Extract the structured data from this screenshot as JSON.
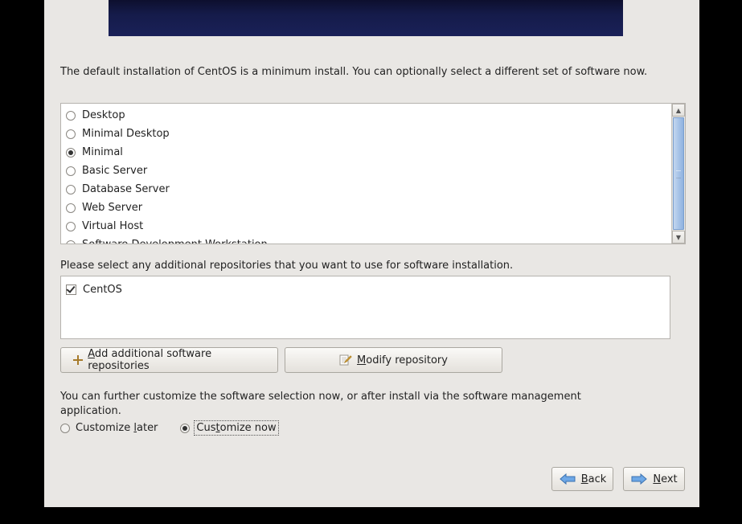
{
  "intro_text": "The default installation of CentOS is a minimum install. You can optionally select a different set of software now.",
  "install_types": [
    {
      "label": "Desktop",
      "selected": false
    },
    {
      "label": "Minimal Desktop",
      "selected": false
    },
    {
      "label": "Minimal",
      "selected": true
    },
    {
      "label": "Basic Server",
      "selected": false
    },
    {
      "label": "Database Server",
      "selected": false
    },
    {
      "label": "Web Server",
      "selected": false
    },
    {
      "label": "Virtual Host",
      "selected": false
    },
    {
      "label": "Software Development Workstation",
      "selected": false
    }
  ],
  "repos_prompt": "Please select any additional repositories that you want to use for software installation.",
  "repos": [
    {
      "label": "CentOS",
      "checked": true
    }
  ],
  "buttons": {
    "add_repo_pre": "A",
    "add_repo_post": "dd additional software repositories",
    "modify_repo_pre": "M",
    "modify_repo_post": "odify repository"
  },
  "customize_text": "You can further customize the software selection now, or after install via the software management application.",
  "customize": {
    "later_pre": "Customize ",
    "later_u": "l",
    "later_post": "ater",
    "now_pre": "Cus",
    "now_u": "t",
    "now_post": "omize now",
    "selected": "now"
  },
  "nav": {
    "back_u": "B",
    "back_post": "ack",
    "next_u": "N",
    "next_post": "ext"
  }
}
